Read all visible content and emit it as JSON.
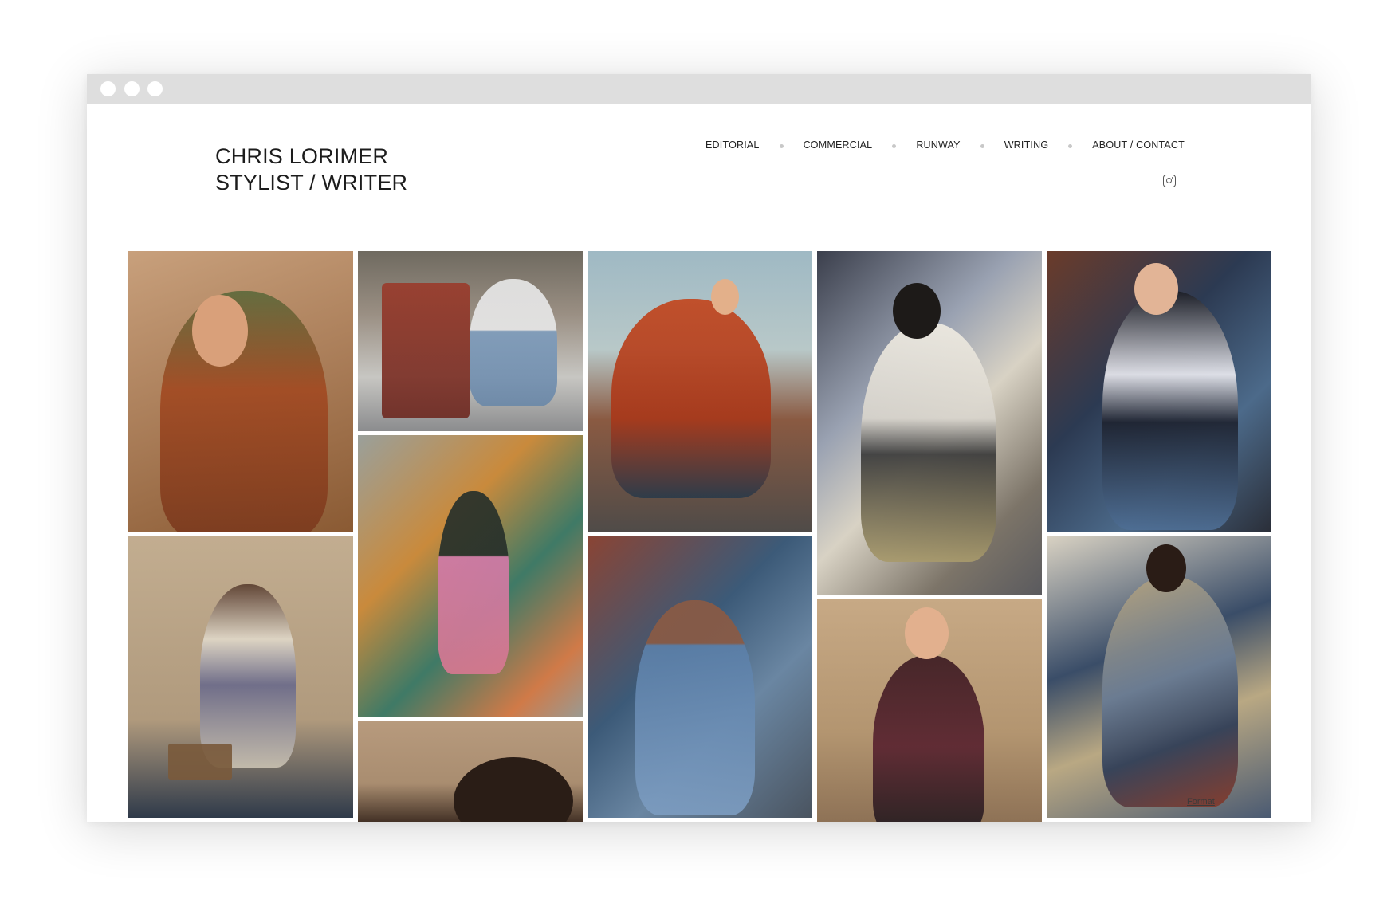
{
  "brand": {
    "line1": "CHRIS LORIMER",
    "line2": "STYLIST / WRITER"
  },
  "nav": {
    "items": [
      {
        "label": "EDITORIAL"
      },
      {
        "label": "COMMERCIAL"
      },
      {
        "label": "RUNWAY"
      },
      {
        "label": "WRITING"
      },
      {
        "label": "ABOUT / CONTACT"
      }
    ]
  },
  "social": {
    "icon": "instagram-icon"
  },
  "footer_badge": {
    "label": "Format"
  },
  "colors": {
    "page_bg": "#ffffff",
    "titlebar": "#dedede",
    "text": "#1c1c1c",
    "separator": "#c8c8c8"
  }
}
